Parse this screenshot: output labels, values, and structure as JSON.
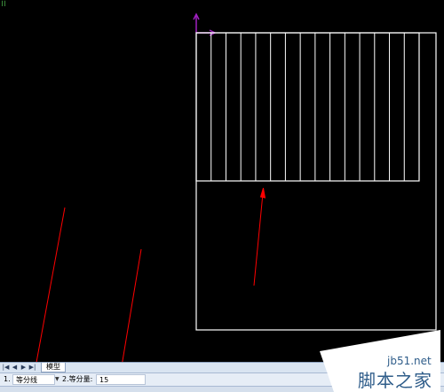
{
  "corner_text": "ii",
  "tabbar": {
    "nav_buttons": [
      {
        "name": "first-tab-icon",
        "glyph": "|◀"
      },
      {
        "name": "prev-tab-icon",
        "glyph": "◀"
      },
      {
        "name": "next-tab-icon",
        "glyph": "▶"
      },
      {
        "name": "last-tab-icon",
        "glyph": "▶|"
      }
    ],
    "model_tab": "模型"
  },
  "parambar": {
    "field1_prefix": "1.",
    "field1_value": "等分线",
    "field2_label": "2.等分量:",
    "field2_value": "15"
  },
  "colors": {
    "background": "#000000",
    "drawing_lines": "#ffffff",
    "annotation_arrows": "#ff0000",
    "ucs_icon": "#a020c0"
  },
  "drawing": {
    "division_count": 15
  },
  "watermark": {
    "url": "jb51.net",
    "site_name": "脚本之家"
  }
}
